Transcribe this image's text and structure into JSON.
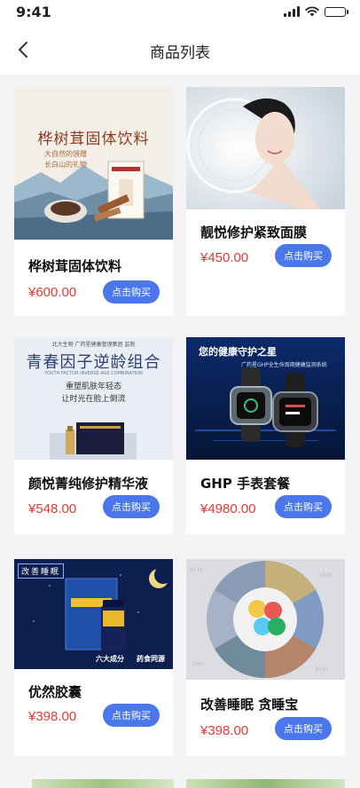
{
  "status": {
    "time": "9:41"
  },
  "nav": {
    "title": "商品列表"
  },
  "products": [
    {
      "name": "桦树茸固体饮料",
      "price": "¥600.00",
      "buy_label": "点击购买",
      "image": {
        "headline": "桦树茸固体饮料",
        "sub1": "大自然的馈赠",
        "sub2": "长白山的礼物"
      }
    },
    {
      "name": "靓悦修护紧致面膜",
      "price": "¥450.00",
      "buy_label": "点击购买",
      "image": {}
    },
    {
      "name": "颜悦菁纯修护精华液",
      "price": "¥548.00",
      "buy_label": "点击购买",
      "image": {
        "top": "北大生物  广药星健康管理集团  监制",
        "headline": "青春因子逆龄组合",
        "en": "YOUTH FACTOR INVERSE AGE COMBINATION",
        "sub1": "重塑肌肤年轻态",
        "sub2": "让时光在脸上倒流"
      }
    },
    {
      "name": "GHP 手表套餐",
      "price": "¥4980.00",
      "buy_label": "点击购买",
      "image": {
        "headline": "您的健康守护之星",
        "sub1": "广药星GHP全生命周期健康监测系统"
      }
    },
    {
      "name": "优然胶囊",
      "price": "¥398.00",
      "buy_label": "点击购买",
      "image": {
        "box_title": "改善睡眠",
        "tag1": "六大成分",
        "tag2": "药食同源"
      }
    },
    {
      "name": "改善睡眠 贪睡宝",
      "price": "¥398.00",
      "buy_label": "点击购买",
      "image": {}
    }
  ]
}
